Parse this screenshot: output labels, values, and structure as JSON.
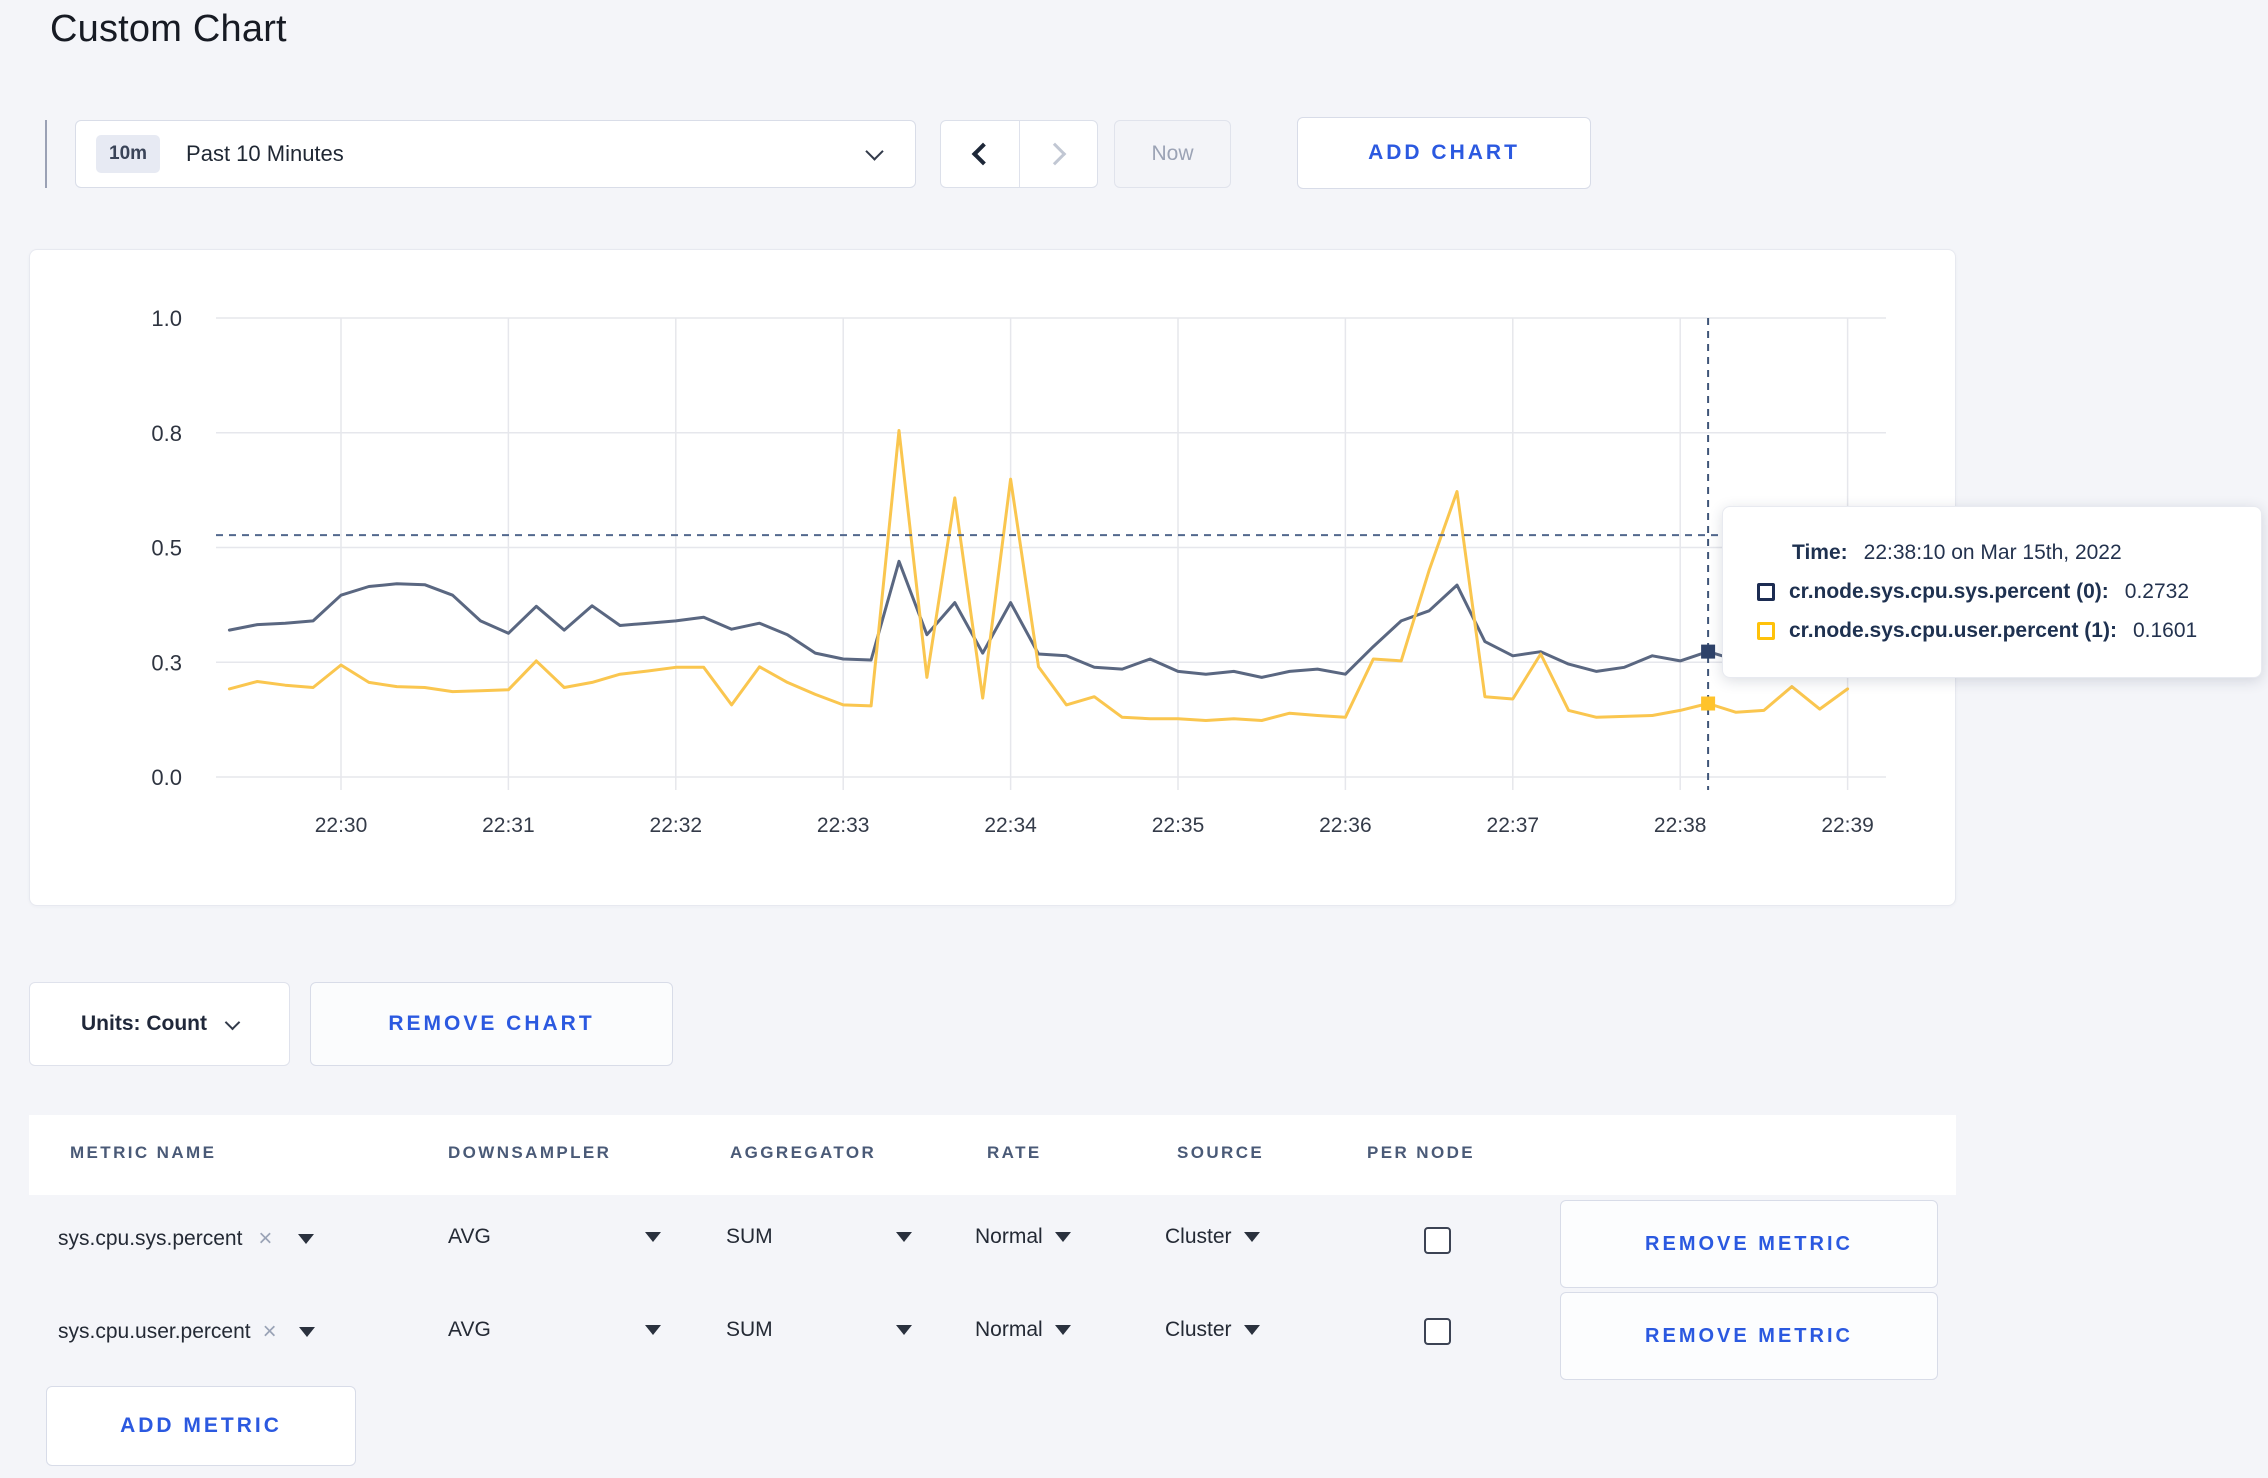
{
  "page": {
    "title": "Custom Chart",
    "background": "#f4f5f9",
    "accent_blue": "#2b59e0"
  },
  "toolbar": {
    "time_window_badge": "10m",
    "time_window_label": "Past 10 Minutes",
    "now_label": "Now",
    "add_chart_label": "ADD CHART"
  },
  "chart_controls": {
    "units_label": "Units: Count",
    "remove_chart_label": "REMOVE CHART",
    "add_metric_label": "ADD METRIC"
  },
  "icons": {
    "clear_x": "×"
  },
  "tooltip": {
    "time_label": "Time:",
    "time_value": "22:38:10 on Mar 15th, 2022",
    "series": [
      {
        "label": "cr.node.sys.cpu.sys.percent (0):",
        "value": "0.2732",
        "color": "#1c2c52"
      },
      {
        "label": "cr.node.sys.cpu.user.percent (1):",
        "value": "0.1601",
        "color": "#ffc20a"
      }
    ]
  },
  "metrics_table": {
    "headers": [
      "METRIC NAME",
      "DOWNSAMPLER",
      "AGGREGATOR",
      "RATE",
      "SOURCE",
      "PER NODE"
    ],
    "remove_metric_label": "REMOVE METRIC",
    "rows": [
      {
        "metric": "sys.cpu.sys.percent",
        "downsampler": "AVG",
        "aggregator": "SUM",
        "rate": "Normal",
        "source": "Cluster",
        "per_node_checked": false
      },
      {
        "metric": "sys.cpu.user.percent",
        "downsampler": "AVG",
        "aggregator": "SUM",
        "rate": "Normal",
        "source": "Cluster",
        "per_node_checked": false
      }
    ]
  },
  "chart_data": {
    "type": "line",
    "title": "",
    "xlabel": "",
    "ylabel": "",
    "grid": true,
    "legend_position": "none",
    "ylim": [
      0,
      1
    ],
    "y_ticks": [
      {
        "value": 0.0,
        "label": "0.0"
      },
      {
        "value": 0.25,
        "label": "0.3"
      },
      {
        "value": 0.5,
        "label": "0.5"
      },
      {
        "value": 0.75,
        "label": "0.8"
      },
      {
        "value": 1.0,
        "label": "1.0"
      }
    ],
    "x_tick_labels": [
      "22:30",
      "22:31",
      "22:32",
      "22:33",
      "22:34",
      "22:35",
      "22:36",
      "22:37",
      "22:38",
      "22:39"
    ],
    "sample_interval_sec": 10,
    "first_sample_offset_sec": -40,
    "time_origin": "22:30:00",
    "series": [
      {
        "name": "cr.node.sys.cpu.sys.percent",
        "color": "#5a6781",
        "marker_color": "#2e4269",
        "values": [
          0.32,
          0.332,
          0.335,
          0.34,
          0.396,
          0.415,
          0.421,
          0.419,
          0.396,
          0.34,
          0.313,
          0.372,
          0.32,
          0.373,
          0.33,
          0.335,
          0.34,
          0.348,
          0.322,
          0.335,
          0.31,
          0.27,
          0.257,
          0.255,
          0.47,
          0.31,
          0.38,
          0.27,
          0.38,
          0.268,
          0.264,
          0.239,
          0.235,
          0.257,
          0.23,
          0.224,
          0.23,
          0.217,
          0.23,
          0.235,
          0.224,
          0.284,
          0.34,
          0.362,
          0.418,
          0.295,
          0.264,
          0.273,
          0.246,
          0.23,
          0.239,
          0.264,
          0.253,
          0.2732,
          0.255,
          0.262,
          0.258,
          0.262,
          0.26
        ]
      },
      {
        "name": "cr.node.sys.cpu.user.percent",
        "color": "#fac64f",
        "marker_color": "#ffc32b",
        "values": [
          0.192,
          0.208,
          0.2,
          0.195,
          0.244,
          0.206,
          0.197,
          0.195,
          0.186,
          0.188,
          0.19,
          0.253,
          0.195,
          0.206,
          0.224,
          0.231,
          0.239,
          0.239,
          0.157,
          0.24,
          0.206,
          0.18,
          0.157,
          0.155,
          0.755,
          0.217,
          0.608,
          0.172,
          0.649,
          0.24,
          0.157,
          0.175,
          0.13,
          0.127,
          0.127,
          0.123,
          0.127,
          0.123,
          0.139,
          0.134,
          0.13,
          0.257,
          0.253,
          0.45,
          0.622,
          0.175,
          0.17,
          0.268,
          0.145,
          0.13,
          0.132,
          0.134,
          0.145,
          0.1601,
          0.141,
          0.145,
          0.197,
          0.148,
          0.192
        ]
      }
    ],
    "crosshair": {
      "time_label": "22:38:10",
      "time_offset_sec": 490,
      "horizontal_value": 0.527,
      "point_values": [
        0.2732,
        0.1601
      ]
    }
  }
}
